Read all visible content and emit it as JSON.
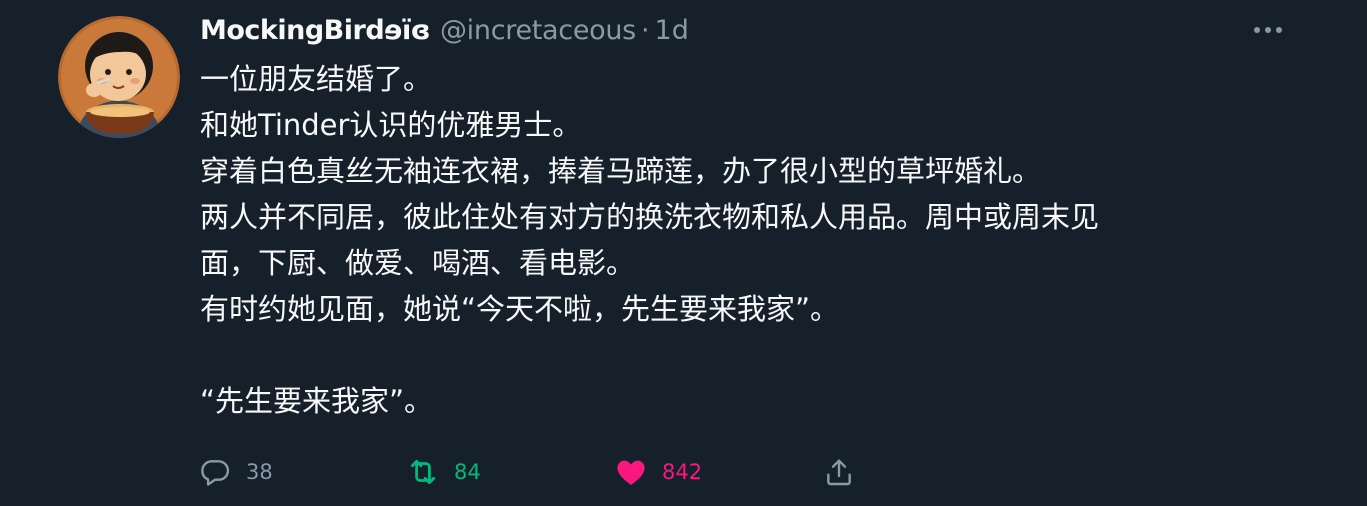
{
  "tweet": {
    "display_name": "MockingBirdɘïɞ",
    "handle": "@incretaceous",
    "separator": "·",
    "time": "1d",
    "lines": [
      "一位朋友结婚了。",
      "和她Tinder认识的优雅男士。",
      "穿着白色真丝无袖连衣裙，捧着马蹄莲，办了很小型的草坪婚礼。",
      "两人并不同居，彼此住处有对方的换洗衣物和私人用品。周中或周末见",
      "面，下厨、做爱、喝酒、看电影。",
      "有时约她见面，她说“今天不啦，先生要来我家”。",
      "",
      "“先生要来我家”。"
    ]
  },
  "actions": {
    "reply_count": "38",
    "retweet_count": "84",
    "like_count": "842"
  },
  "icons": {
    "more": "more-horizontal-icon",
    "reply": "reply-bubble-icon",
    "retweet": "retweet-icon",
    "like": "heart-filled-icon",
    "share": "share-upload-icon"
  },
  "colors": {
    "background": "#15202b",
    "text_primary": "#f7f9f9",
    "text_secondary": "#8b98a5",
    "retweet_green": "#00ba7c",
    "like_pink": "#f91880"
  }
}
